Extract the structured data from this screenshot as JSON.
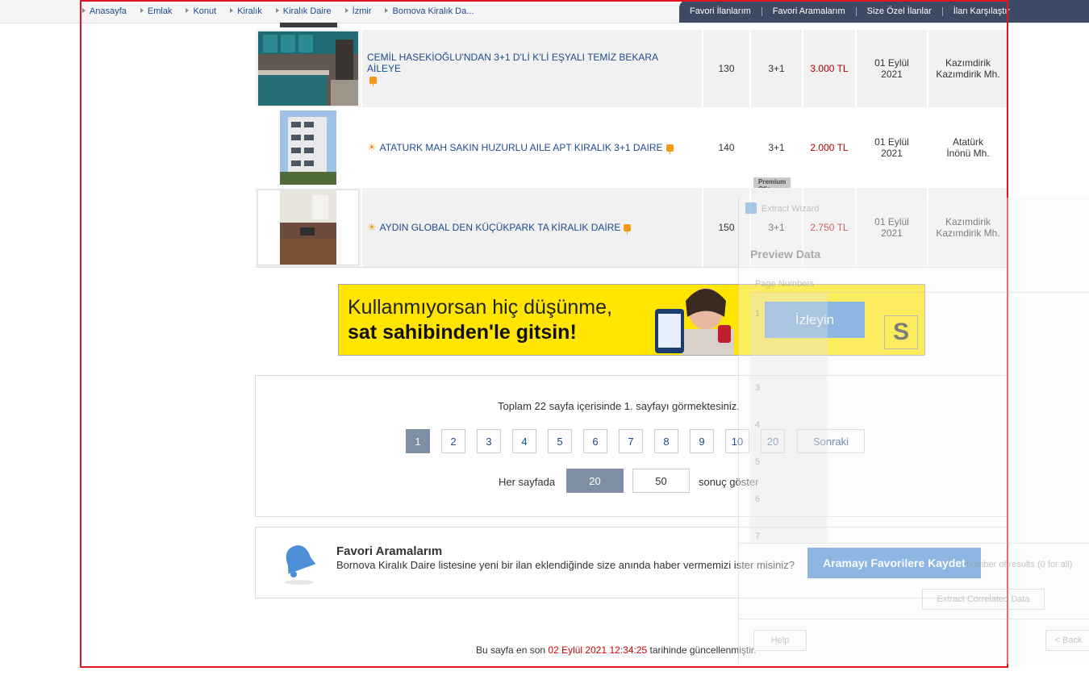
{
  "breadcrumb": [
    "Anasayfa",
    "Emlak",
    "Konut",
    "Kiralık",
    "Kiralık Daire",
    "İzmir",
    "Bornova Kiralık Da..."
  ],
  "top_nav": [
    "Favori İlanlarım",
    "Favori Aramalarım",
    "Size Özel İlanlar",
    "İlan Karşılaştır"
  ],
  "listings": [
    {
      "title": "CEMİL HASEKİOĞLU'NDAN 3+1 D'Lİ K'Lİ EŞYALI TEMİZ BEKARA AİLEYE",
      "m2": "130",
      "rooms": "3+1",
      "price": "3.000 TL",
      "date_day": "01 Eylül",
      "date_year": "2021",
      "loc_1": "Kazımdirik",
      "loc_2": "Kazımdirik Mh."
    },
    {
      "title": "ATATURK MAH SAKIN HUZURLU AILE APT KIRALIK 3+1 DAIRE",
      "m2": "140",
      "rooms": "3+1",
      "price": "2.000 TL",
      "date_day": "01 Eylül",
      "date_year": "2021",
      "loc_1": "Atatürk",
      "loc_2": "İnönü Mh.",
      "badge": "Premium Ofis"
    },
    {
      "title": "AYDIN GLOBAL DEN KÜÇÜKPARK TA KİRALIK DAİRE",
      "m2": "150",
      "rooms": "3+1",
      "price": "2.750 TL",
      "date_day": "01 Eylül",
      "date_year": "2021",
      "loc_1": "Kazımdirik",
      "loc_2": "Kazımdirik Mh."
    }
  ],
  "banner": {
    "line1": "Kullanmıyorsan hiç düşünme,",
    "line2": "sat sahibinden'le gitsin!",
    "cta": "İzleyin",
    "logo": "S"
  },
  "pagination": {
    "summary": "Toplam 22 sayfa içerisinde 1. sayfayı görmektesiniz.",
    "pages": [
      "1",
      "2",
      "3",
      "4",
      "5",
      "6",
      "7",
      "8",
      "9",
      "10",
      "20"
    ],
    "current": "1",
    "next": "Sonraki",
    "per_page_label": "Her sayfada",
    "per_page_options": [
      "20",
      "50"
    ],
    "per_page_selected": "20",
    "per_page_suffix": "sonuç göster"
  },
  "favorites": {
    "title": "Favori Aramalarım",
    "desc": "Bornova Kiralık Daire listesine yeni bir ilan eklendiğinde size anında haber vermemizi ister misiniz?",
    "button": "Aramayı Favorilere Kaydet"
  },
  "footer": {
    "prefix": "Bu sayfa en son",
    "datetime": "02 Eylül 2021 12:34:25",
    "suffix": "tarihinde güncellenmiştir."
  },
  "wizard": {
    "title": "Extract Wizard",
    "heading": "Preview Data",
    "column": "Page Numbers",
    "rows": [
      "1",
      "3",
      "4",
      "5",
      "6",
      "7"
    ],
    "option": "number of results (0 for all)",
    "correlated": "Extract Correlated Data",
    "help": "Help",
    "back": "< Back"
  },
  "colors": {
    "link": "#1c4b8c",
    "price": "#b10000",
    "nav_bg": "#3e4a63",
    "frame": "#e0141e",
    "banner_bg": "#ffe500",
    "accent": "#4c8fd6"
  }
}
